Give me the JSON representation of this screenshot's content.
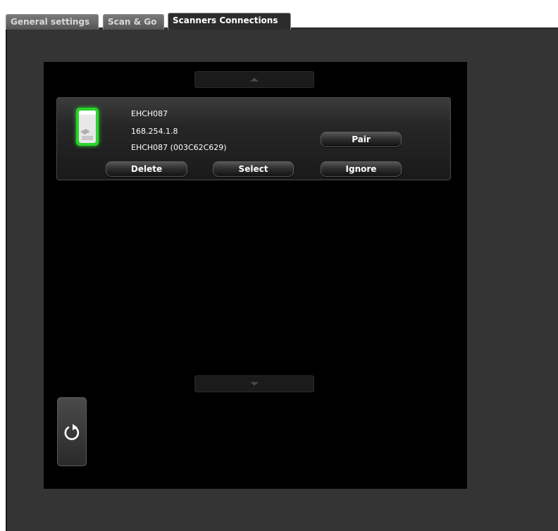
{
  "tabs": [
    {
      "label": "General settings",
      "active": false
    },
    {
      "label": "Scan & Go",
      "active": false
    },
    {
      "label": "Scanners Connections",
      "active": true
    }
  ],
  "scanner": {
    "name": "EHCH087",
    "ip": "168.254.1.8",
    "id": "EHCH087 (003C62C629)",
    "status_color": "#2bd42b"
  },
  "buttons": {
    "pair": "Pair",
    "delete": "Delete",
    "select": "Select",
    "ignore": "Ignore"
  },
  "icons": {
    "scroll_up": "triangle-up-icon",
    "scroll_down": "triangle-down-icon",
    "refresh": "refresh-icon",
    "scanner": "scanner-device-icon"
  }
}
